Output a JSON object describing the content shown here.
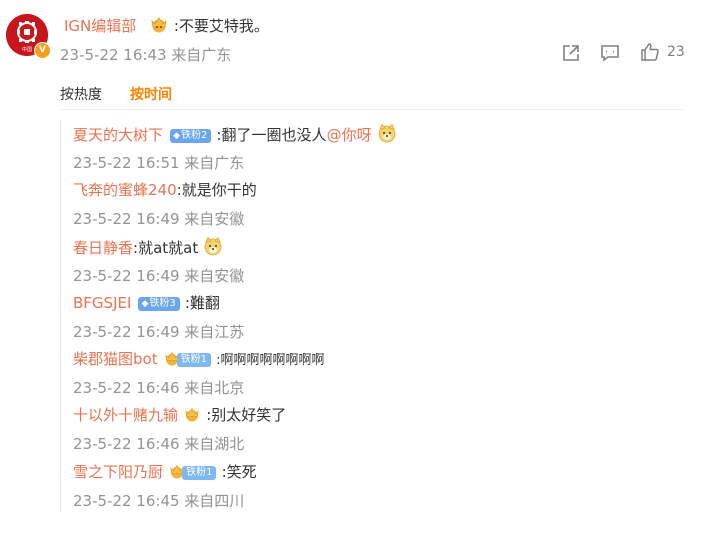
{
  "comment": {
    "author": "IGN编辑部",
    "text": ":不要艾特我。",
    "meta": "23-5-22 16:43 来自广东",
    "like_count": "23",
    "avatar_caption": "中国",
    "verified_badge": "V"
  },
  "sort_tabs": {
    "hot": "按热度",
    "time": "按时间"
  },
  "colors": {
    "username": "#eb7350",
    "active_tab": "#ff8200",
    "meta": "#939393",
    "fan_badge": "#6aa6ee"
  },
  "replies": [
    {
      "user": "夏天的大树下",
      "badge": "铁粉2",
      "badge_type": "diamond",
      "text": ":翻了一圈也没人",
      "mention": "@你呀",
      "emoji": "doge-icon",
      "meta": "23-5-22 16:51 来自广东"
    },
    {
      "user": "飞奔的蜜蜂240",
      "badge": "",
      "text": ":就是你干的",
      "meta": "23-5-22 16:49 来自安徽"
    },
    {
      "user": "春日静香",
      "badge": "",
      "text": ":就at就at",
      "emoji": "doge-icon",
      "meta": "23-5-22 16:49 来自安徽"
    },
    {
      "user": "BFGSJEI",
      "badge": "铁粉3",
      "badge_type": "diamond",
      "text": ":難翻",
      "meta": "23-5-22 16:49 来自江苏"
    },
    {
      "user": "柴郡猫图bot",
      "badge": "铁粉1",
      "badge_type": "crown",
      "text": ":啊啊啊啊啊啊啊啊",
      "meta": "23-5-22 16:46 来自北京"
    },
    {
      "user": "十以外十赌九输",
      "badge": "",
      "badge_type": "crown-only",
      "text": ":别太好笑了",
      "meta": "23-5-22 16:46 来自湖北"
    },
    {
      "user": "雪之下阳乃厨",
      "badge": "铁粉1",
      "badge_type": "crown",
      "text": ":笑死",
      "meta": "23-5-22 16:45 来自四川"
    }
  ]
}
